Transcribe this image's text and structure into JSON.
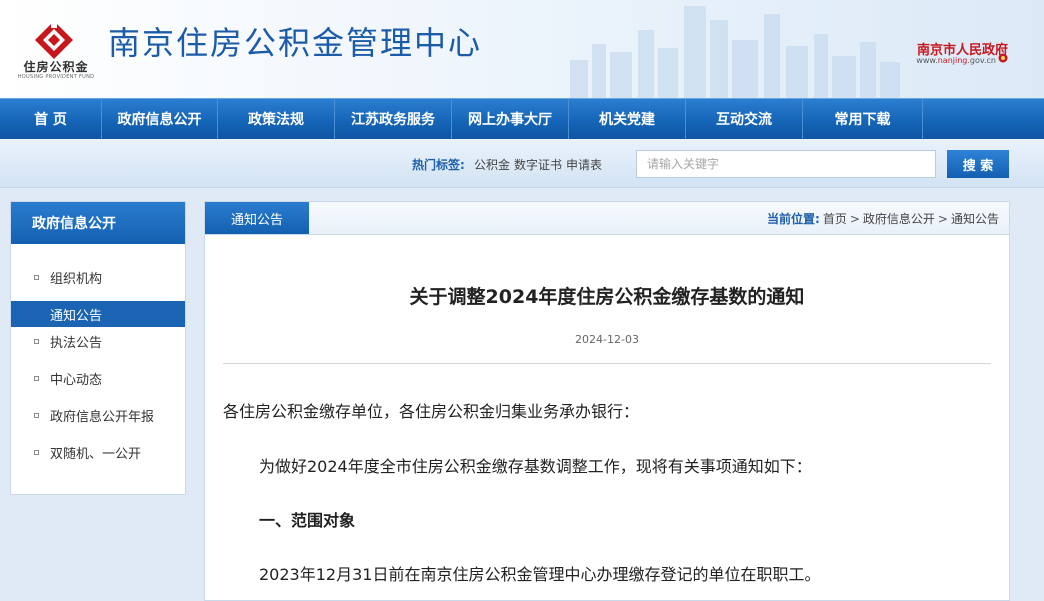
{
  "header": {
    "logo_text": "住房公积金",
    "logo_subtext": "HOUSING PROVIDENT FUND",
    "site_title": "南京住房公积金管理中心",
    "gov_name": "南京市人民政府",
    "gov_url_prefix": "www.",
    "gov_url_highlight": "nanjing",
    "gov_url_suffix": ".gov.cn"
  },
  "nav": {
    "items": [
      {
        "label": "首 页"
      },
      {
        "label": "政府信息公开"
      },
      {
        "label": "政策法规"
      },
      {
        "label": "江苏政务服务"
      },
      {
        "label": "网上办事大厅"
      },
      {
        "label": "机关党建"
      },
      {
        "label": "互动交流"
      },
      {
        "label": "常用下载"
      }
    ]
  },
  "search": {
    "hot_label": "热门标签:",
    "tags": [
      "公积金",
      "数字证书",
      "申请表"
    ],
    "placeholder": "请输入关键字",
    "button_label": "搜 索"
  },
  "sidebar": {
    "title": "政府信息公开",
    "items": [
      {
        "label": "组织机构",
        "active": false
      },
      {
        "label": "通知公告",
        "active": true
      },
      {
        "label": "执法公告",
        "active": false
      },
      {
        "label": "中心动态",
        "active": false
      },
      {
        "label": "政府信息公开年报",
        "active": false
      },
      {
        "label": "双随机、一公开",
        "active": false
      }
    ]
  },
  "main": {
    "tab_label": "通知公告",
    "breadcrumb": {
      "current_label": "当前位置:",
      "items": [
        "首页",
        "政府信息公开",
        "通知公告"
      ],
      "separator": ">"
    },
    "article": {
      "title": "关于调整2024年度住房公积金缴存基数的通知",
      "date": "2024-12-03",
      "paragraphs": [
        "各住房公积金缴存单位，各住房公积金归集业务承办银行：",
        "为做好2024年度全市住房公积金缴存基数调整工作，现将有关事项通知如下：",
        "一、范围对象",
        "2023年12月31日前在南京住房公积金管理中心办理缴存登记的单位在职职工。"
      ]
    }
  },
  "colors": {
    "brand_blue": "#1565b8",
    "title_blue": "#1c5ba8",
    "gov_red": "#c8161d",
    "logo_red": "#c8161d"
  }
}
